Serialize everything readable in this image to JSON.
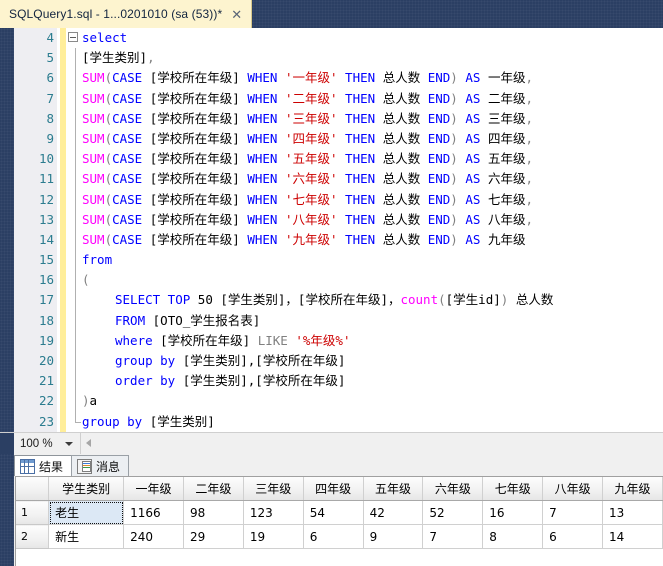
{
  "window": {
    "tab": {
      "title": "SQLQuery1.sql - 1...0201010 (sa (53))*",
      "close_label": "✕"
    }
  },
  "editor": {
    "lines": [
      {
        "num": "4",
        "indent": 1,
        "glyph": "collapse-minus",
        "tokens": [
          {
            "t": "select",
            "c": "k"
          }
        ]
      },
      {
        "num": "5",
        "indent": 1,
        "tokens": [
          {
            "t": "[学生类别]",
            "c": "id"
          },
          {
            "t": ",",
            "c": "p"
          }
        ]
      },
      {
        "num": "6",
        "indent": 1,
        "tokens": [
          {
            "t": "SUM",
            "c": "fn"
          },
          {
            "t": "(",
            "c": "p"
          },
          {
            "t": "CASE ",
            "c": "k"
          },
          {
            "t": "[学校所在年级] ",
            "c": "id"
          },
          {
            "t": "WHEN ",
            "c": "k"
          },
          {
            "t": "'一年级' ",
            "c": "s"
          },
          {
            "t": "THEN ",
            "c": "k"
          },
          {
            "t": "总人数 ",
            "c": "id"
          },
          {
            "t": "END",
            "c": "k"
          },
          {
            "t": ") ",
            "c": "p"
          },
          {
            "t": "AS ",
            "c": "k"
          },
          {
            "t": "一年级",
            "c": "id"
          },
          {
            "t": ",",
            "c": "p"
          }
        ]
      },
      {
        "num": "7",
        "indent": 1,
        "tokens": [
          {
            "t": "SUM",
            "c": "fn"
          },
          {
            "t": "(",
            "c": "p"
          },
          {
            "t": "CASE ",
            "c": "k"
          },
          {
            "t": "[学校所在年级] ",
            "c": "id"
          },
          {
            "t": "WHEN ",
            "c": "k"
          },
          {
            "t": "'二年级' ",
            "c": "s"
          },
          {
            "t": "THEN ",
            "c": "k"
          },
          {
            "t": "总人数 ",
            "c": "id"
          },
          {
            "t": "END",
            "c": "k"
          },
          {
            "t": ") ",
            "c": "p"
          },
          {
            "t": "AS ",
            "c": "k"
          },
          {
            "t": "二年级",
            "c": "id"
          },
          {
            "t": ",",
            "c": "p"
          }
        ]
      },
      {
        "num": "8",
        "indent": 1,
        "tokens": [
          {
            "t": "SUM",
            "c": "fn"
          },
          {
            "t": "(",
            "c": "p"
          },
          {
            "t": "CASE ",
            "c": "k"
          },
          {
            "t": "[学校所在年级] ",
            "c": "id"
          },
          {
            "t": "WHEN ",
            "c": "k"
          },
          {
            "t": "'三年级' ",
            "c": "s"
          },
          {
            "t": "THEN ",
            "c": "k"
          },
          {
            "t": "总人数 ",
            "c": "id"
          },
          {
            "t": "END",
            "c": "k"
          },
          {
            "t": ") ",
            "c": "p"
          },
          {
            "t": "AS ",
            "c": "k"
          },
          {
            "t": "三年级",
            "c": "id"
          },
          {
            "t": ",",
            "c": "p"
          }
        ]
      },
      {
        "num": "9",
        "indent": 1,
        "tokens": [
          {
            "t": "SUM",
            "c": "fn"
          },
          {
            "t": "(",
            "c": "p"
          },
          {
            "t": "CASE ",
            "c": "k"
          },
          {
            "t": "[学校所在年级] ",
            "c": "id"
          },
          {
            "t": "WHEN ",
            "c": "k"
          },
          {
            "t": "'四年级' ",
            "c": "s"
          },
          {
            "t": "THEN ",
            "c": "k"
          },
          {
            "t": "总人数 ",
            "c": "id"
          },
          {
            "t": "END",
            "c": "k"
          },
          {
            "t": ") ",
            "c": "p"
          },
          {
            "t": "AS ",
            "c": "k"
          },
          {
            "t": "四年级",
            "c": "id"
          },
          {
            "t": ",",
            "c": "p"
          }
        ]
      },
      {
        "num": "10",
        "indent": 1,
        "tokens": [
          {
            "t": "SUM",
            "c": "fn"
          },
          {
            "t": "(",
            "c": "p"
          },
          {
            "t": "CASE ",
            "c": "k"
          },
          {
            "t": "[学校所在年级] ",
            "c": "id"
          },
          {
            "t": "WHEN ",
            "c": "k"
          },
          {
            "t": "'五年级' ",
            "c": "s"
          },
          {
            "t": "THEN ",
            "c": "k"
          },
          {
            "t": "总人数 ",
            "c": "id"
          },
          {
            "t": "END",
            "c": "k"
          },
          {
            "t": ") ",
            "c": "p"
          },
          {
            "t": "AS ",
            "c": "k"
          },
          {
            "t": "五年级",
            "c": "id"
          },
          {
            "t": ",",
            "c": "p"
          }
        ]
      },
      {
        "num": "11",
        "indent": 1,
        "tokens": [
          {
            "t": "SUM",
            "c": "fn"
          },
          {
            "t": "(",
            "c": "p"
          },
          {
            "t": "CASE ",
            "c": "k"
          },
          {
            "t": "[学校所在年级] ",
            "c": "id"
          },
          {
            "t": "WHEN ",
            "c": "k"
          },
          {
            "t": "'六年级' ",
            "c": "s"
          },
          {
            "t": "THEN ",
            "c": "k"
          },
          {
            "t": "总人数 ",
            "c": "id"
          },
          {
            "t": "END",
            "c": "k"
          },
          {
            "t": ") ",
            "c": "p"
          },
          {
            "t": "AS ",
            "c": "k"
          },
          {
            "t": "六年级",
            "c": "id"
          },
          {
            "t": ",",
            "c": "p"
          }
        ]
      },
      {
        "num": "12",
        "indent": 1,
        "tokens": [
          {
            "t": "SUM",
            "c": "fn"
          },
          {
            "t": "(",
            "c": "p"
          },
          {
            "t": "CASE ",
            "c": "k"
          },
          {
            "t": "[学校所在年级] ",
            "c": "id"
          },
          {
            "t": "WHEN ",
            "c": "k"
          },
          {
            "t": "'七年级' ",
            "c": "s"
          },
          {
            "t": "THEN ",
            "c": "k"
          },
          {
            "t": "总人数 ",
            "c": "id"
          },
          {
            "t": "END",
            "c": "k"
          },
          {
            "t": ") ",
            "c": "p"
          },
          {
            "t": "AS ",
            "c": "k"
          },
          {
            "t": "七年级",
            "c": "id"
          },
          {
            "t": ",",
            "c": "p"
          }
        ]
      },
      {
        "num": "13",
        "indent": 1,
        "tokens": [
          {
            "t": "SUM",
            "c": "fn"
          },
          {
            "t": "(",
            "c": "p"
          },
          {
            "t": "CASE ",
            "c": "k"
          },
          {
            "t": "[学校所在年级] ",
            "c": "id"
          },
          {
            "t": "WHEN ",
            "c": "k"
          },
          {
            "t": "'八年级' ",
            "c": "s"
          },
          {
            "t": "THEN ",
            "c": "k"
          },
          {
            "t": "总人数 ",
            "c": "id"
          },
          {
            "t": "END",
            "c": "k"
          },
          {
            "t": ") ",
            "c": "p"
          },
          {
            "t": "AS ",
            "c": "k"
          },
          {
            "t": "八年级",
            "c": "id"
          },
          {
            "t": ",",
            "c": "p"
          }
        ]
      },
      {
        "num": "14",
        "indent": 1,
        "tokens": [
          {
            "t": "SUM",
            "c": "fn"
          },
          {
            "t": "(",
            "c": "p"
          },
          {
            "t": "CASE ",
            "c": "k"
          },
          {
            "t": "[学校所在年级] ",
            "c": "id"
          },
          {
            "t": "WHEN ",
            "c": "k"
          },
          {
            "t": "'九年级' ",
            "c": "s"
          },
          {
            "t": "THEN ",
            "c": "k"
          },
          {
            "t": "总人数 ",
            "c": "id"
          },
          {
            "t": "END",
            "c": "k"
          },
          {
            "t": ") ",
            "c": "p"
          },
          {
            "t": "AS ",
            "c": "k"
          },
          {
            "t": "九年级",
            "c": "id"
          }
        ]
      },
      {
        "num": "15",
        "indent": 1,
        "tokens": [
          {
            "t": "from",
            "c": "k"
          }
        ]
      },
      {
        "num": "16",
        "indent": 1,
        "tokens": [
          {
            "t": "(",
            "c": "p"
          }
        ]
      },
      {
        "num": "17",
        "indent": 2,
        "tokens": [
          {
            "t": "SELECT TOP ",
            "c": "k"
          },
          {
            "t": "50 ",
            "c": "n"
          },
          {
            "t": "[学生类别]，[学校所在年级]，",
            "c": "id"
          },
          {
            "t": "count",
            "c": "fn"
          },
          {
            "t": "(",
            "c": "p"
          },
          {
            "t": "[学生id]",
            "c": "id"
          },
          {
            "t": ") ",
            "c": "p"
          },
          {
            "t": "总人数",
            "c": "id"
          }
        ]
      },
      {
        "num": "18",
        "indent": 2,
        "tokens": [
          {
            "t": "FROM ",
            "c": "k"
          },
          {
            "t": "[OTO_学生报名表]",
            "c": "id"
          }
        ]
      },
      {
        "num": "19",
        "indent": 2,
        "tokens": [
          {
            "t": "where ",
            "c": "k"
          },
          {
            "t": "[学校所在年级] ",
            "c": "id"
          },
          {
            "t": "LIKE ",
            "c": "p"
          },
          {
            "t": "'%年级%'",
            "c": "s"
          }
        ]
      },
      {
        "num": "20",
        "indent": 2,
        "tokens": [
          {
            "t": "group by  ",
            "c": "k"
          },
          {
            "t": "[学生类别],[学校所在年级]",
            "c": "id"
          }
        ]
      },
      {
        "num": "21",
        "indent": 2,
        "tokens": [
          {
            "t": "order by  ",
            "c": "k"
          },
          {
            "t": "[学生类别],[学校所在年级]",
            "c": "id"
          }
        ]
      },
      {
        "num": "22",
        "indent": 1,
        "tokens": [
          {
            "t": ")",
            "c": "p"
          },
          {
            "t": "a",
            "c": "id"
          }
        ]
      },
      {
        "num": "23",
        "indent": 1,
        "tokens": [
          {
            "t": "group by ",
            "c": "k"
          },
          {
            "t": "[学生类别]",
            "c": "id"
          }
        ]
      }
    ]
  },
  "statusbar": {
    "zoom": "100 %"
  },
  "results": {
    "tabs": [
      {
        "label": "结果",
        "icon": "grid-icon",
        "active": true
      },
      {
        "label": "消息",
        "icon": "message-icon",
        "active": false
      }
    ],
    "grid": {
      "columns": [
        "学生类别",
        "一年级",
        "二年级",
        "三年级",
        "四年级",
        "五年级",
        "六年级",
        "七年级",
        "八年级",
        "九年级"
      ],
      "rows": [
        {
          "num": "1",
          "cells": [
            "老生",
            "1166",
            "98",
            "123",
            "54",
            "42",
            "52",
            "16",
            "7",
            "13"
          ],
          "selected_cell": 0
        },
        {
          "num": "2",
          "cells": [
            "新生",
            "240",
            "29",
            "19",
            "6",
            "9",
            "7",
            "8",
            "6",
            "14"
          ],
          "selected_cell": -1
        }
      ]
    }
  }
}
